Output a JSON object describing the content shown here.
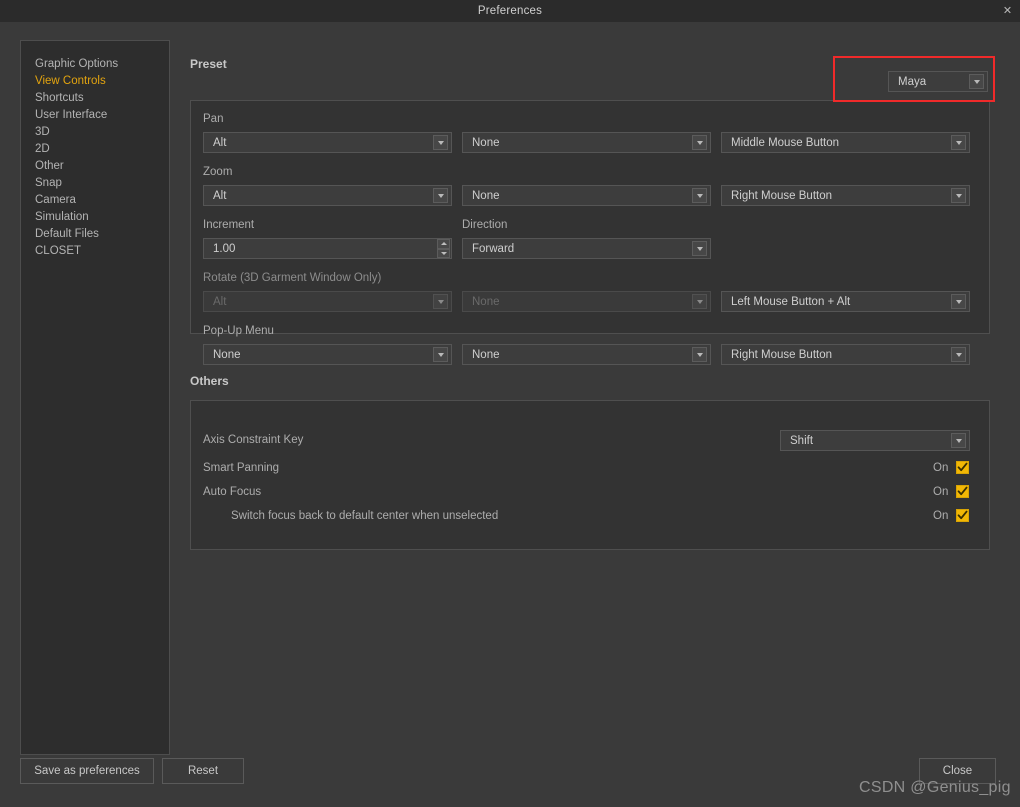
{
  "window": {
    "title": "Preferences",
    "close_icon": "close-icon",
    "close_glyph": "✕"
  },
  "sidebar": {
    "items": [
      {
        "label": "Graphic Options",
        "active": false
      },
      {
        "label": "View Controls",
        "active": true
      },
      {
        "label": "Shortcuts",
        "active": false
      },
      {
        "label": "User Interface",
        "active": false
      },
      {
        "label": "3D",
        "active": false
      },
      {
        "label": "2D",
        "active": false
      },
      {
        "label": "Other",
        "active": false
      },
      {
        "label": "Snap",
        "active": false
      },
      {
        "label": "Camera",
        "active": false
      },
      {
        "label": "Simulation",
        "active": false
      },
      {
        "label": "Default Files",
        "active": false
      },
      {
        "label": "CLOSET",
        "active": false
      }
    ]
  },
  "preset": {
    "section_label": "Preset",
    "value": "Maya",
    "highlight_color": "#f02a2a"
  },
  "controls": {
    "rows": [
      {
        "label": "Pan",
        "col1": "Alt",
        "col2": "None",
        "col3": "Middle Mouse Button",
        "disabled": false
      },
      {
        "label": "Zoom",
        "col1": "Alt",
        "col2": "None",
        "col3": "Right Mouse Button",
        "disabled": false
      },
      {
        "label": "Rotate (3D Garment Window Only)",
        "col1": "Alt",
        "col2": "None",
        "col3": "Left Mouse Button + Alt",
        "disabled": true
      },
      {
        "label": "Pop-Up Menu",
        "col1": "None",
        "col2": "None",
        "col3": "Right Mouse Button",
        "disabled": false
      }
    ],
    "increment": {
      "label": "Increment",
      "value": "1.00"
    },
    "direction": {
      "label": "Direction",
      "value": "Forward"
    }
  },
  "others": {
    "section_label": "Others",
    "axis_constraint": {
      "label": "Axis Constraint Key",
      "value": "Shift"
    },
    "toggles": [
      {
        "label": "Smart Panning",
        "state": "On",
        "checked": true,
        "indent": false
      },
      {
        "label": "Auto Focus",
        "state": "On",
        "checked": true,
        "indent": false
      },
      {
        "label": "Switch focus back to default center when unselected",
        "state": "On",
        "checked": true,
        "indent": true
      }
    ]
  },
  "footer": {
    "save_label": "Save as preferences",
    "reset_label": "Reset",
    "close_label": "Close"
  },
  "watermark": {
    "text": "CSDN @Genius_pig"
  }
}
